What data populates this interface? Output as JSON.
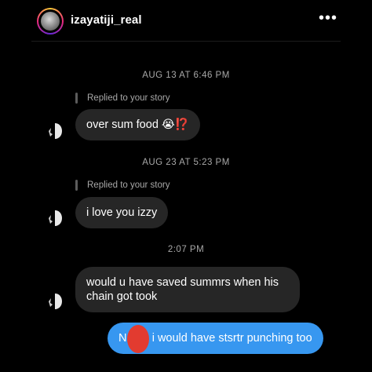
{
  "header": {
    "username": "izayatiji_real",
    "more_label": "•••"
  },
  "messages": [
    {
      "timestamp": "AUG 13 AT 6:46 PM",
      "reply_label": "Replied to your story",
      "text": "over sum food 😭⁉️"
    },
    {
      "timestamp": "AUG 23 AT 5:23 PM",
      "reply_label": "Replied to your story",
      "text": "i love you izzy"
    },
    {
      "timestamp": "2:07 PM",
      "text": "would u have saved summrs when his chain got took"
    }
  ],
  "sent": {
    "text": "N     a i would have stsrtr punching too"
  },
  "colors": {
    "sent_bubble": "#3797f0",
    "received_bubble": "#262626",
    "background": "#000000"
  }
}
